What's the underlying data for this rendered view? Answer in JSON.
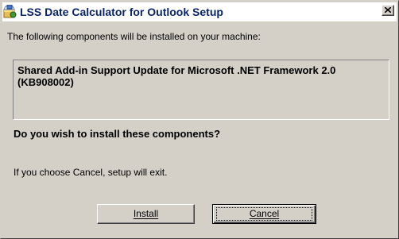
{
  "window": {
    "title": "LSS Date Calculator for Outlook Setup",
    "icon": "setup-installer-icon",
    "close_icon": "close-icon"
  },
  "content": {
    "intro": "The following components will be installed on your machine:",
    "components": [
      "Shared Add-in Support Update for Microsoft .NET Framework 2.0 (KB908002)"
    ],
    "question": "Do you wish to install these components?",
    "cancel_note": "If you choose Cancel, setup will exit."
  },
  "buttons": {
    "install_label": "Install",
    "cancel_label": "Cancel"
  },
  "colors": {
    "dialog_face": "#d4d0c8",
    "title_text": "#0a246a"
  }
}
